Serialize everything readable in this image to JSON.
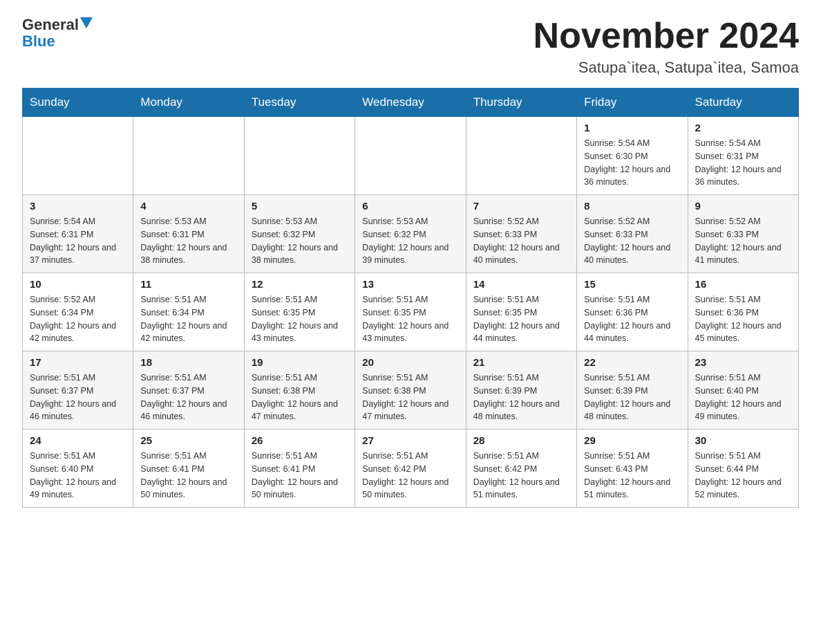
{
  "header": {
    "logo_general": "General",
    "logo_blue": "Blue",
    "month_title": "November 2024",
    "location": "Satupa`itea, Satupa`itea, Samoa"
  },
  "days_of_week": [
    "Sunday",
    "Monday",
    "Tuesday",
    "Wednesday",
    "Thursday",
    "Friday",
    "Saturday"
  ],
  "weeks": [
    [
      {
        "day": "",
        "info": ""
      },
      {
        "day": "",
        "info": ""
      },
      {
        "day": "",
        "info": ""
      },
      {
        "day": "",
        "info": ""
      },
      {
        "day": "",
        "info": ""
      },
      {
        "day": "1",
        "info": "Sunrise: 5:54 AM\nSunset: 6:30 PM\nDaylight: 12 hours and 36 minutes."
      },
      {
        "day": "2",
        "info": "Sunrise: 5:54 AM\nSunset: 6:31 PM\nDaylight: 12 hours and 36 minutes."
      }
    ],
    [
      {
        "day": "3",
        "info": "Sunrise: 5:54 AM\nSunset: 6:31 PM\nDaylight: 12 hours and 37 minutes."
      },
      {
        "day": "4",
        "info": "Sunrise: 5:53 AM\nSunset: 6:31 PM\nDaylight: 12 hours and 38 minutes."
      },
      {
        "day": "5",
        "info": "Sunrise: 5:53 AM\nSunset: 6:32 PM\nDaylight: 12 hours and 38 minutes."
      },
      {
        "day": "6",
        "info": "Sunrise: 5:53 AM\nSunset: 6:32 PM\nDaylight: 12 hours and 39 minutes."
      },
      {
        "day": "7",
        "info": "Sunrise: 5:52 AM\nSunset: 6:33 PM\nDaylight: 12 hours and 40 minutes."
      },
      {
        "day": "8",
        "info": "Sunrise: 5:52 AM\nSunset: 6:33 PM\nDaylight: 12 hours and 40 minutes."
      },
      {
        "day": "9",
        "info": "Sunrise: 5:52 AM\nSunset: 6:33 PM\nDaylight: 12 hours and 41 minutes."
      }
    ],
    [
      {
        "day": "10",
        "info": "Sunrise: 5:52 AM\nSunset: 6:34 PM\nDaylight: 12 hours and 42 minutes."
      },
      {
        "day": "11",
        "info": "Sunrise: 5:51 AM\nSunset: 6:34 PM\nDaylight: 12 hours and 42 minutes."
      },
      {
        "day": "12",
        "info": "Sunrise: 5:51 AM\nSunset: 6:35 PM\nDaylight: 12 hours and 43 minutes."
      },
      {
        "day": "13",
        "info": "Sunrise: 5:51 AM\nSunset: 6:35 PM\nDaylight: 12 hours and 43 minutes."
      },
      {
        "day": "14",
        "info": "Sunrise: 5:51 AM\nSunset: 6:35 PM\nDaylight: 12 hours and 44 minutes."
      },
      {
        "day": "15",
        "info": "Sunrise: 5:51 AM\nSunset: 6:36 PM\nDaylight: 12 hours and 44 minutes."
      },
      {
        "day": "16",
        "info": "Sunrise: 5:51 AM\nSunset: 6:36 PM\nDaylight: 12 hours and 45 minutes."
      }
    ],
    [
      {
        "day": "17",
        "info": "Sunrise: 5:51 AM\nSunset: 6:37 PM\nDaylight: 12 hours and 46 minutes."
      },
      {
        "day": "18",
        "info": "Sunrise: 5:51 AM\nSunset: 6:37 PM\nDaylight: 12 hours and 46 minutes."
      },
      {
        "day": "19",
        "info": "Sunrise: 5:51 AM\nSunset: 6:38 PM\nDaylight: 12 hours and 47 minutes."
      },
      {
        "day": "20",
        "info": "Sunrise: 5:51 AM\nSunset: 6:38 PM\nDaylight: 12 hours and 47 minutes."
      },
      {
        "day": "21",
        "info": "Sunrise: 5:51 AM\nSunset: 6:39 PM\nDaylight: 12 hours and 48 minutes."
      },
      {
        "day": "22",
        "info": "Sunrise: 5:51 AM\nSunset: 6:39 PM\nDaylight: 12 hours and 48 minutes."
      },
      {
        "day": "23",
        "info": "Sunrise: 5:51 AM\nSunset: 6:40 PM\nDaylight: 12 hours and 49 minutes."
      }
    ],
    [
      {
        "day": "24",
        "info": "Sunrise: 5:51 AM\nSunset: 6:40 PM\nDaylight: 12 hours and 49 minutes."
      },
      {
        "day": "25",
        "info": "Sunrise: 5:51 AM\nSunset: 6:41 PM\nDaylight: 12 hours and 50 minutes."
      },
      {
        "day": "26",
        "info": "Sunrise: 5:51 AM\nSunset: 6:41 PM\nDaylight: 12 hours and 50 minutes."
      },
      {
        "day": "27",
        "info": "Sunrise: 5:51 AM\nSunset: 6:42 PM\nDaylight: 12 hours and 50 minutes."
      },
      {
        "day": "28",
        "info": "Sunrise: 5:51 AM\nSunset: 6:42 PM\nDaylight: 12 hours and 51 minutes."
      },
      {
        "day": "29",
        "info": "Sunrise: 5:51 AM\nSunset: 6:43 PM\nDaylight: 12 hours and 51 minutes."
      },
      {
        "day": "30",
        "info": "Sunrise: 5:51 AM\nSunset: 6:44 PM\nDaylight: 12 hours and 52 minutes."
      }
    ]
  ]
}
